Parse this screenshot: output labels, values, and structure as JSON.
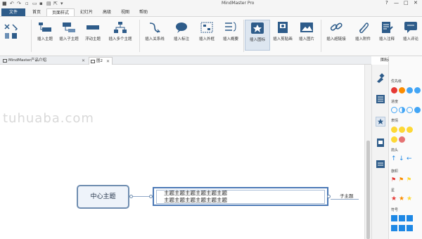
{
  "window": {
    "title": "MindMaster Pro",
    "controls": [
      "?",
      "—",
      "□",
      "✕"
    ]
  },
  "menu": {
    "file": "文件",
    "tabs": [
      "首页",
      "页面样式",
      "幻灯片",
      "高级",
      "视图",
      "帮助"
    ],
    "active_tab": "页面样式"
  },
  "ribbon": {
    "buttons": [
      {
        "id": "insert-main-topic",
        "label": "插入主题",
        "icon": "main-topic-icon"
      },
      {
        "id": "insert-subtopic",
        "label": "插入子主题",
        "icon": "subtopic-icon"
      },
      {
        "id": "floating-topic",
        "label": "浮动主题",
        "icon": "floating-topic-icon"
      },
      {
        "id": "insert-multiple-topics",
        "label": "插入多个主题",
        "icon": "multi-topic-icon"
      },
      {
        "id": "insert-relationship",
        "label": "插入关系线",
        "icon": "relationship-icon"
      },
      {
        "id": "insert-callout",
        "label": "插入标注",
        "icon": "callout-icon"
      },
      {
        "id": "insert-boundary",
        "label": "插入外框",
        "icon": "boundary-icon"
      },
      {
        "id": "insert-summary",
        "label": "插入概要",
        "icon": "summary-icon"
      },
      {
        "id": "insert-icon",
        "label": "插入图标",
        "icon": "icon-library-icon"
      },
      {
        "id": "insert-clipart",
        "label": "插入剪贴画",
        "icon": "clipart-icon"
      },
      {
        "id": "insert-picture",
        "label": "插入图片",
        "icon": "picture-icon"
      },
      {
        "id": "insert-hyperlink",
        "label": "插入超链接",
        "icon": "hyperlink-icon"
      },
      {
        "id": "insert-attachment",
        "label": "插入附件",
        "icon": "attachment-icon"
      },
      {
        "id": "insert-note",
        "label": "插入注释",
        "icon": "note-icon"
      },
      {
        "id": "insert-comment",
        "label": "插入评论",
        "icon": "comment-icon"
      }
    ]
  },
  "tabs": [
    {
      "label": "MindMaster产品介绍",
      "active": false
    },
    {
      "label": "图2",
      "active": true
    }
  ],
  "canvas": {
    "watermark": "tuhuaba.com",
    "central_topic": "中心主题",
    "main_topic_line1": "主题主题主题主题主题主题",
    "main_topic_line2": "主题主题主题主题主题主题",
    "subtopic": "子主题"
  },
  "panel": {
    "title": "图标",
    "categories": [
      "优先级",
      "进度",
      "表情",
      "箭头",
      "旗帜",
      "星",
      "符号"
    ],
    "colors": {
      "priority_red": "#e53935",
      "priority_orange": "#fb8c00",
      "progress_blue": "#42a5f5",
      "smiley_yellow": "#fdd835",
      "arrow_blue": "#1e88e5",
      "flag_red": "#e53935",
      "star_red": "#e53935",
      "star_orange": "#fb8c00",
      "symbol_blue": "#1e88e5",
      "accent": "#2e5c8a"
    }
  }
}
